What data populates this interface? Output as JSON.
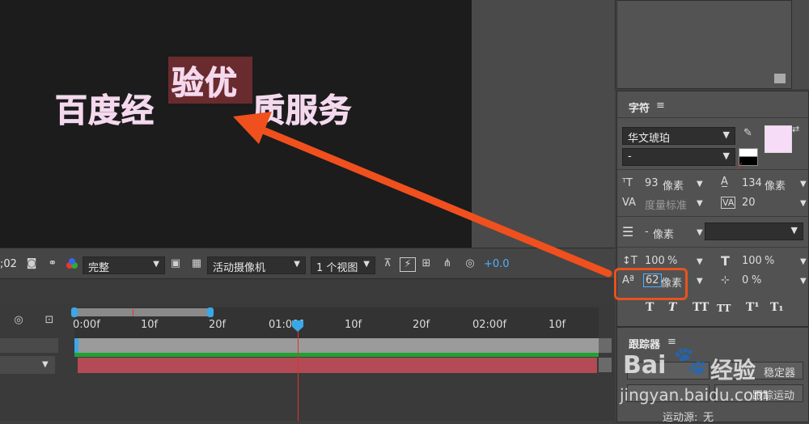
{
  "composition": {
    "text_left": "百度经",
    "text_middle": "验优",
    "text_right": "质服务"
  },
  "comp_toolbar": {
    "timecode": ";02",
    "resolution": "完整",
    "camera": "活动摄像机",
    "views": "1 个视图",
    "exposure": "+0.0"
  },
  "timeline": {
    "ticks": [
      "0:00f",
      "10f",
      "20f",
      "01:00f",
      "10f",
      "20f",
      "02:00f",
      "10f"
    ]
  },
  "character_panel": {
    "title": "字符",
    "font_family": "华文琥珀",
    "font_style": "-",
    "font_size": "93",
    "font_size_unit": "像素",
    "leading": "134",
    "leading_unit": "像素",
    "kerning": "度量标准",
    "tracking": "20",
    "stroke_width": "-",
    "stroke_unit": "像素",
    "vertical_scale": "100",
    "vertical_scale_unit": "%",
    "horizontal_scale": "100",
    "horizontal_scale_unit": "%",
    "baseline_shift": "62",
    "baseline_shift_unit": "像素",
    "tsume": "0",
    "tsume_unit": "%",
    "text_style_buttons": [
      "T",
      "T",
      "TT",
      "TT",
      "T¹",
      "T₁"
    ],
    "fill_color": "#f7dcf7",
    "stroke_color": "#2a2a2a"
  },
  "tracker_panel": {
    "title": "跟踪器",
    "row1_right": "稳定器",
    "row2_right": "跟踪运动",
    "motion_source_label": "运动源:",
    "motion_source_value": "无"
  },
  "watermark": {
    "brand": "Bai",
    "brand_suffix": "经验",
    "url": "jingyan.baidu.com"
  },
  "colors": {
    "highlight": "#e8531f",
    "arrow": "#f0501e",
    "value_blue": "#4fb0ff"
  }
}
